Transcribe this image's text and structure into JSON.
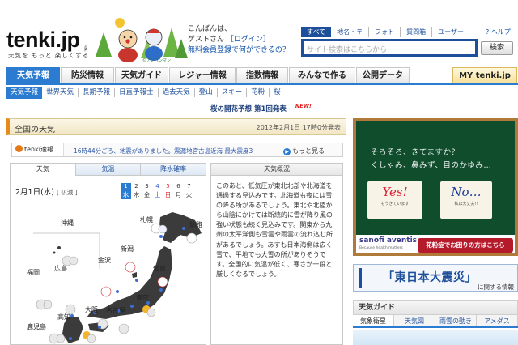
{
  "header": {
    "logo": "tenki.jp",
    "logo_beta": "β",
    "tagline": "天気を もっと 楽しくする",
    "greeting_line1": "こんばんは、",
    "greeting_name": "ゲストさん",
    "greeting_login": "［ログイン］",
    "greeting_register": "無料会員登録で何ができるの？",
    "mascot_caption": "©アンパンマン"
  },
  "search": {
    "tabs": [
      "すべて",
      "地名・〒",
      "フォト",
      "質問箱",
      "ユーザー"
    ],
    "active_tab": 0,
    "placeholder": "サイト検索はこちらから",
    "button": "検索",
    "help": "ヘルプ"
  },
  "main_nav": {
    "items": [
      "天気予報",
      "防災情報",
      "天気ガイド",
      "レジャー情報",
      "指数情報",
      "みんなで作る",
      "公開データ",
      "MY tenki.jp"
    ],
    "active": 0
  },
  "sub_nav": {
    "items": [
      "天気予報",
      "世界天気",
      "長期予報",
      "日直予報士",
      "過去天気",
      "登山",
      "スキー",
      "花粉",
      "桜"
    ],
    "active": 0
  },
  "sakura_notice": {
    "text": "桜の開花予想 第1回発表",
    "badge": "NEW!"
  },
  "panel": {
    "title": "全国の天気",
    "date": "2012年2月1日 17時0分発表"
  },
  "quake": {
    "label": "tenki速報",
    "text": "16時44分ごろ、地震がありました。震源地宮古島近海 最大震度3",
    "more": "もっと見る"
  },
  "map": {
    "tabs": [
      "天気",
      "気温",
      "降水確率"
    ],
    "active_tab": 0,
    "date": "2月1日(水)",
    "date_sub": "[ 仏滅 ]",
    "days": [
      {
        "n": "1",
        "d": "水"
      },
      {
        "n": "2",
        "d": "木"
      },
      {
        "n": "3",
        "d": "金"
      },
      {
        "n": "4",
        "d": "土"
      },
      {
        "n": "5",
        "d": "日"
      },
      {
        "n": "6",
        "d": "月"
      },
      {
        "n": "7",
        "d": "火"
      }
    ],
    "cities": [
      "札幌",
      "釧路",
      "沖縄",
      "新潟",
      "金沢",
      "仙台",
      "福岡",
      "広島",
      "東京",
      "大阪",
      "名古屋",
      "高知",
      "鹿児島"
    ]
  },
  "overview": {
    "title": "天気概況",
    "body": "このあと、低気圧が東北北部や北海道を通過する見込みです。北海道も夜には雪の降る所があるでしょう。東北や北陸から山陰にかけては断続的に雪が降り風の強い状態も続く見込みです。関東から九州の太平洋側も雪雲や雨雲の流れ込む所があるでしょう。あすも日本海側は広く雪で、平地でも大雪の所がありそうです。全国的に気温が低く、寒さが一段と厳しくなるでしょう。"
  },
  "ad": {
    "line1": "そろそろ、きてますか？",
    "line2": "くしゃみ、鼻みず、目のかゆみ…",
    "yes": "Yes!",
    "yes_sub": "もうきています",
    "no": "No…",
    "no_sub": "私は大丈夫!!",
    "brand": "sanofi aventis",
    "brand_tag": "Because health matters",
    "button": "花粉症でお困りの方はこちら"
  },
  "quake_banner": {
    "title": "「東日本大震災」",
    "sub": "に関する情報"
  },
  "guide": {
    "title": "天気ガイド",
    "tabs": [
      "気象衛星",
      "天気図",
      "雨雲の動き",
      "アメダス"
    ],
    "active_tab": 0
  },
  "colors": {
    "nav_blue": "#2b7bd0",
    "search_blue": "#1e4f9a",
    "link_blue": "#1d4f9c",
    "alert_orange": "#e37a13",
    "board_green": "#0f4d2c",
    "pollen_red": "#b51a2b"
  }
}
